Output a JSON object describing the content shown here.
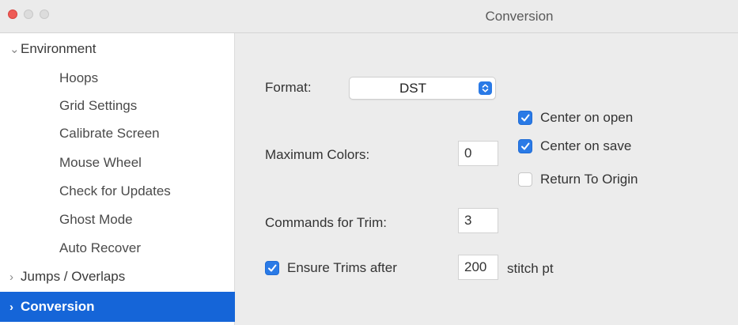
{
  "window": {
    "title": "Conversion"
  },
  "sidebar": {
    "items": [
      {
        "label": "Environment",
        "expanded": true,
        "chevron": "chevron-down"
      },
      {
        "label": "Hoops"
      },
      {
        "label": "Grid Settings"
      },
      {
        "label": "Calibrate Screen"
      },
      {
        "label": "Mouse Wheel"
      },
      {
        "label": "Check for Updates"
      },
      {
        "label": "Ghost Mode"
      },
      {
        "label": "Auto Recover"
      },
      {
        "label": "Jumps / Overlaps",
        "expanded": false,
        "chevron": "chevron-right"
      },
      {
        "label": "Conversion",
        "selected": true,
        "chevron": "chevron-right"
      }
    ],
    "selected_color": "#1565d8"
  },
  "form": {
    "format_label": "Format:",
    "format_value": "DST",
    "max_colors_label": "Maximum Colors:",
    "max_colors_value": "0",
    "center_on_open": {
      "label": "Center on open",
      "checked": true
    },
    "center_on_save": {
      "label": "Center on save",
      "checked": true
    },
    "return_to_origin": {
      "label": "Return To Origin",
      "checked": false
    },
    "commands_for_trim_label": "Commands for Trim:",
    "commands_for_trim_value": "3",
    "ensure_trims": {
      "label": "Ensure Trims after",
      "checked": true
    },
    "ensure_trims_value": "200",
    "ensure_trims_unit": "stitch pt"
  },
  "colors": {
    "accent": "#2a7ae6",
    "close_button": "#ee5b56"
  }
}
